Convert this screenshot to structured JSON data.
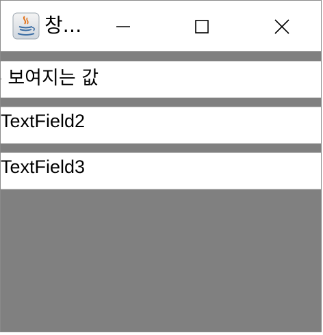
{
  "window": {
    "title": "창...",
    "app_icon": "java-coffee-icon",
    "controls": {
      "minimize_icon": "minimize-icon",
      "maximize_icon": "maximize-icon",
      "close_icon": "close-icon"
    }
  },
  "fields": [
    {
      "value": "- 보여지는 값"
    },
    {
      "value": "TextField2"
    },
    {
      "value": "TextField3"
    }
  ],
  "colors": {
    "content_background": "#808080",
    "titlebar_background": "#ffffff",
    "field_background": "#ffffff"
  }
}
